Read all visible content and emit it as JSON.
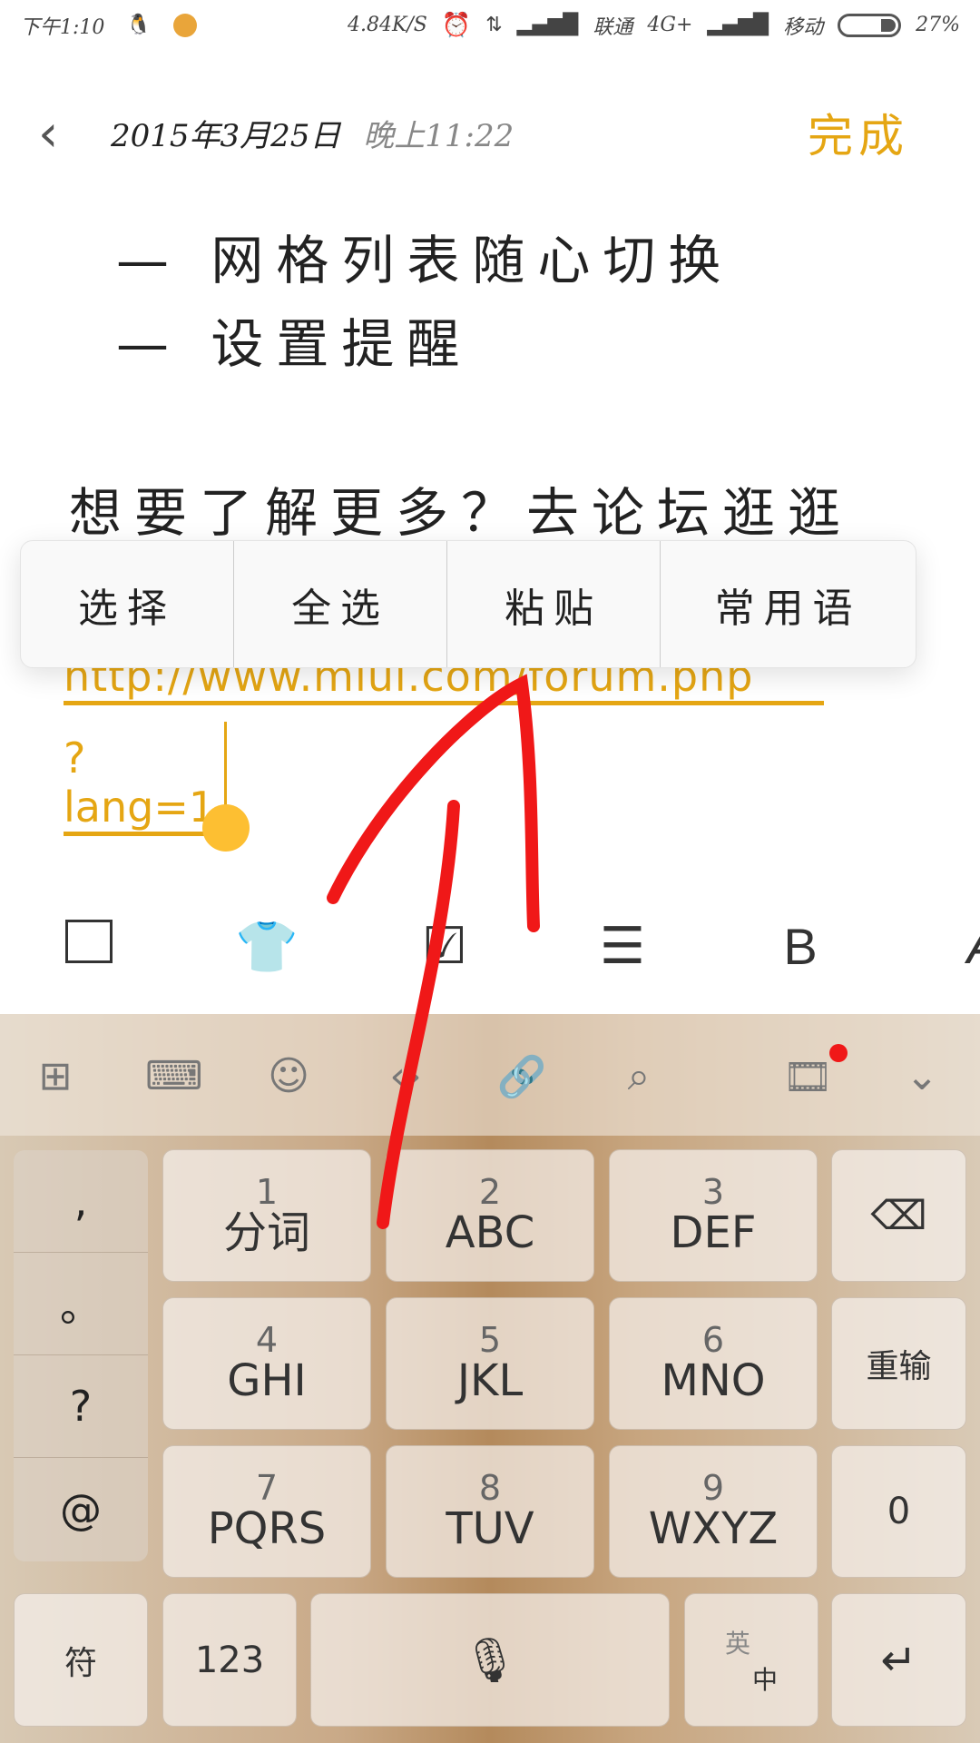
{
  "status": {
    "time": "下午1:10",
    "speed": "4.84K/S",
    "carrier1": "联通",
    "network": "4G+",
    "carrier2": "移动",
    "battery": "27%",
    "battery_level": 27,
    "icons": [
      "qq-icon",
      "app-icon",
      "alarm-icon",
      "data-arrows-icon",
      "signal-icon",
      "signal-icon",
      "battery-icon"
    ]
  },
  "header": {
    "date": "2015年3月25日",
    "time": "晚上11:22",
    "done": "完成"
  },
  "note": {
    "lines": [
      "— 网格列表随心切换",
      "— 设置提醒"
    ],
    "more": "想要了解更多？去论坛逛逛",
    "link1": "http://www.miui.com/forum.php",
    "link2": "?lang=1"
  },
  "menu": {
    "items": [
      "选择",
      "全选",
      "粘贴",
      "常用语"
    ]
  },
  "colors": {
    "accent": "#e5a613",
    "annotation": "#f01818"
  },
  "toolbar": {
    "icons": [
      "image-icon",
      "shirt-icon",
      "checkbox-icon",
      "align-icon",
      "bold-icon",
      "italic-icon"
    ],
    "bold": "B"
  },
  "keyboard": {
    "top_icons": [
      "grid-icon",
      "keyboard-icon",
      "emoji-icon",
      "cursor-icon",
      "link-icon",
      "search-icon",
      "video-icon",
      "chevron-down-icon"
    ],
    "side": [
      ",",
      "。",
      "?",
      "@"
    ],
    "keys": [
      {
        "n": "1",
        "l": "分词"
      },
      {
        "n": "2",
        "l": "ABC"
      },
      {
        "n": "3",
        "l": "DEF"
      },
      {
        "n": "4",
        "l": "GHI"
      },
      {
        "n": "5",
        "l": "JKL"
      },
      {
        "n": "6",
        "l": "MNO"
      },
      {
        "n": "7",
        "l": "PQRS"
      },
      {
        "n": "8",
        "l": "TUV"
      },
      {
        "n": "9",
        "l": "WXYZ"
      }
    ],
    "retype": "重输",
    "zero": "0",
    "symbols": "符",
    "num": "123",
    "lang_top": "英",
    "lang_bottom": "中"
  }
}
